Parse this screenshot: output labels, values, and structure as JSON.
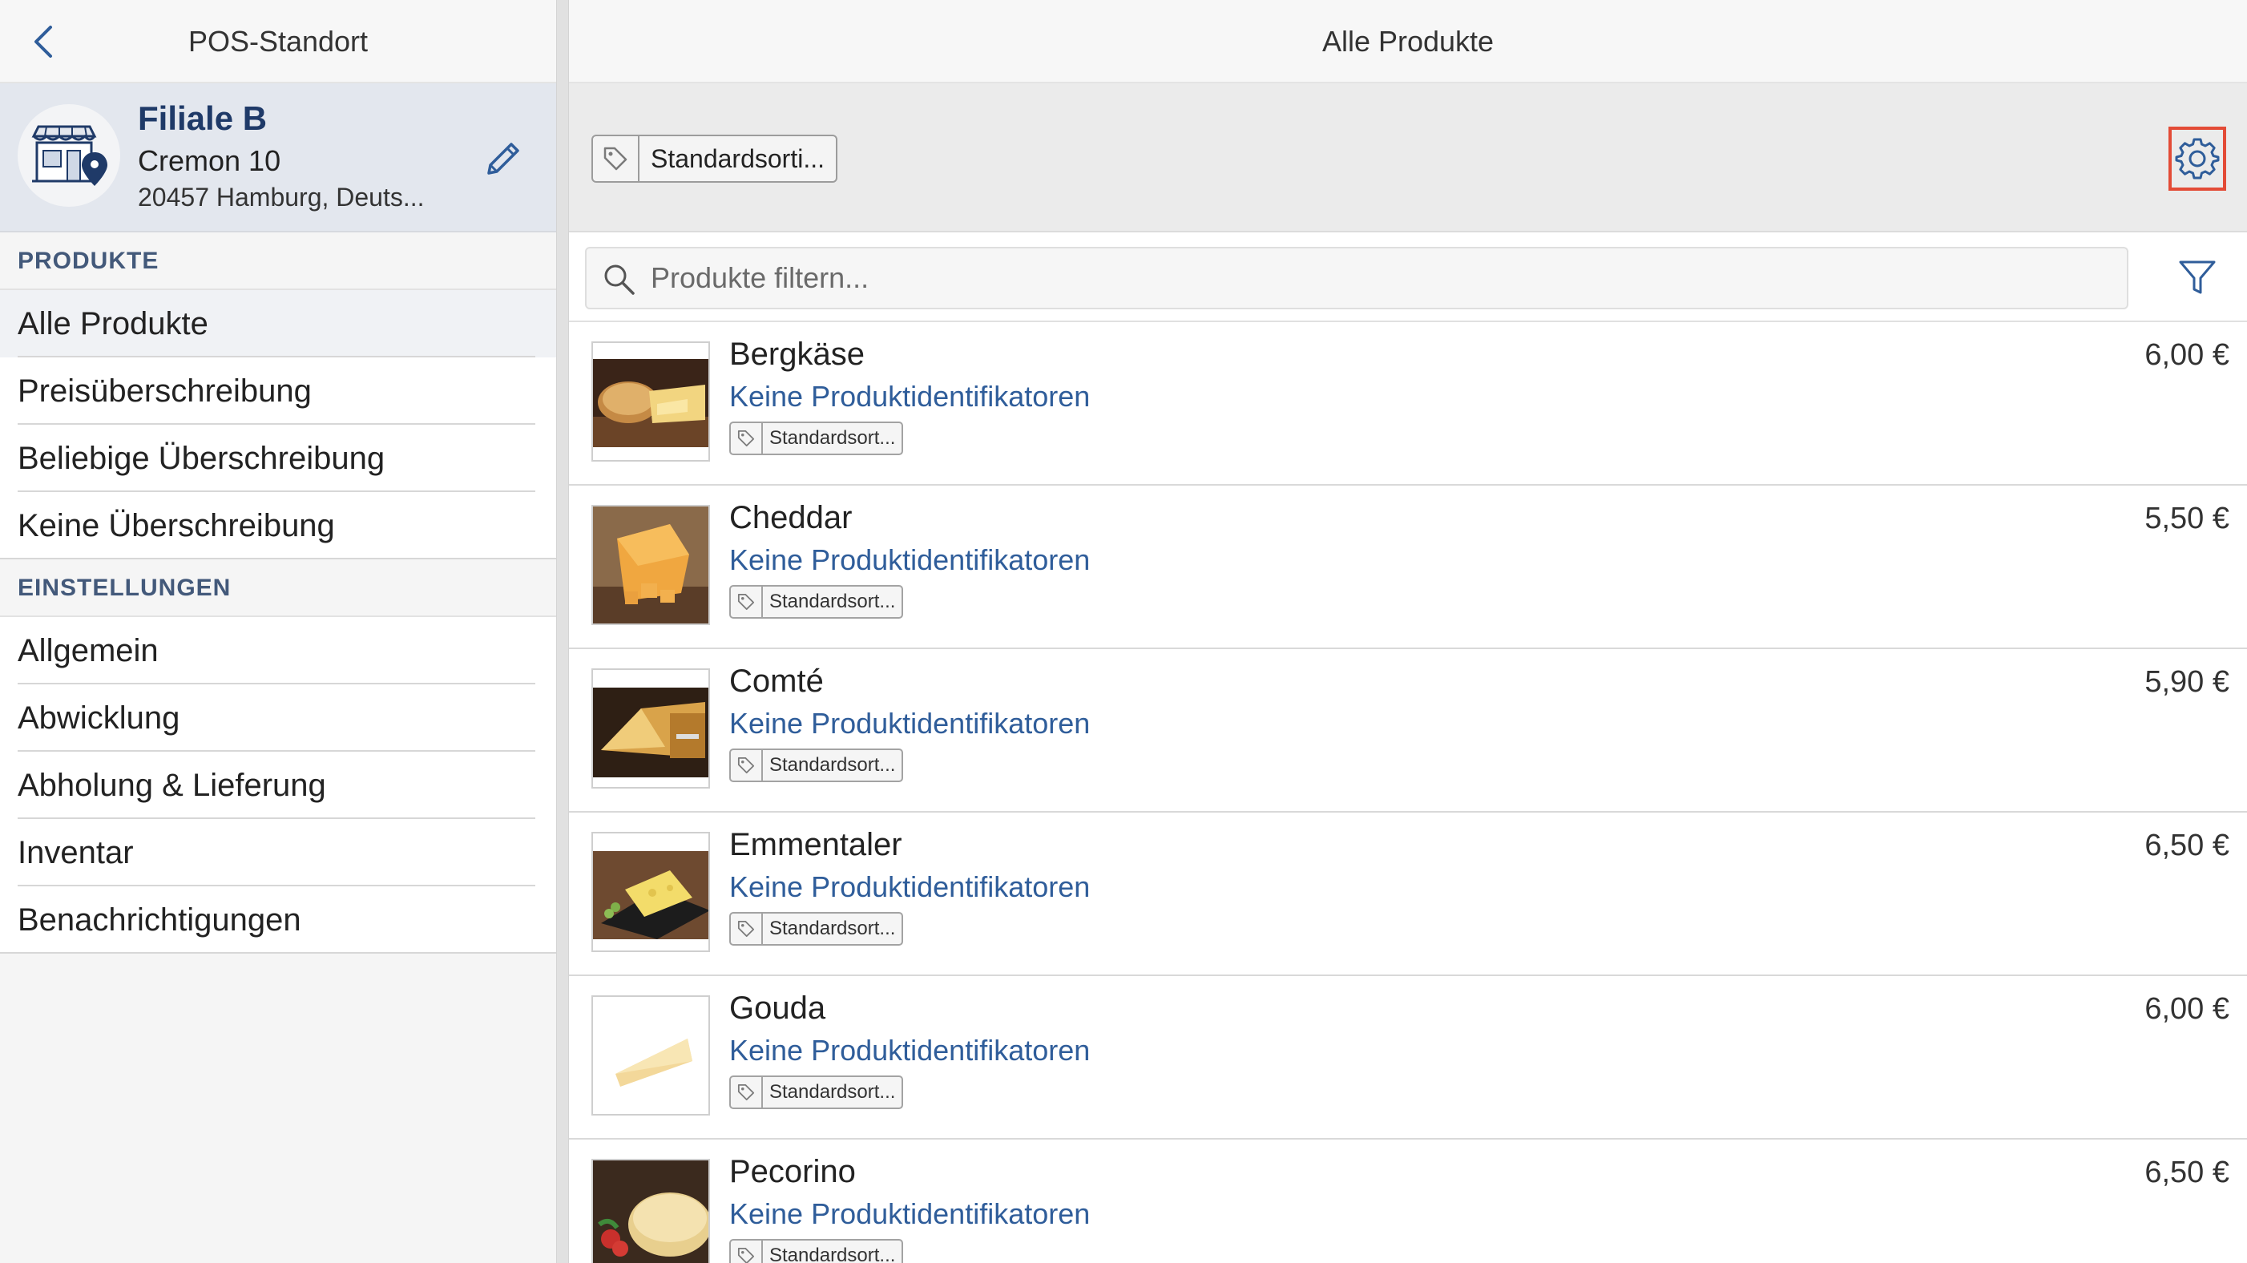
{
  "left_header": {
    "title": "POS-Standort"
  },
  "store": {
    "name": "Filiale B",
    "street": "Cremon 10",
    "city": "20457 Hamburg, Deuts..."
  },
  "sections": [
    {
      "title": "PRODUKTE"
    },
    {
      "title": "EINSTELLUNGEN"
    }
  ],
  "nav_products": [
    {
      "label": "Alle Produkte"
    },
    {
      "label": "Preisüberschreibung"
    },
    {
      "label": "Beliebige Überschreibung"
    },
    {
      "label": "Keine Überschreibung"
    }
  ],
  "nav_settings": [
    {
      "label": "Allgemein"
    },
    {
      "label": "Abwicklung"
    },
    {
      "label": "Abholung & Lieferung"
    },
    {
      "label": "Inventar"
    },
    {
      "label": "Benachrichtigungen"
    }
  ],
  "right_header": {
    "title": "Alle Produkte"
  },
  "toolbar": {
    "assortment_label": "Standardsorti..."
  },
  "search": {
    "placeholder": "Produkte filtern..."
  },
  "products": [
    {
      "name": "Bergkäse",
      "ids": "Keine Produktidentifikatoren",
      "tag": "Standardsort...",
      "price": "6,00 €"
    },
    {
      "name": "Cheddar",
      "ids": "Keine Produktidentifikatoren",
      "tag": "Standardsort...",
      "price": "5,50 €"
    },
    {
      "name": "Comté",
      "ids": "Keine Produktidentifikatoren",
      "tag": "Standardsort...",
      "price": "5,90 €"
    },
    {
      "name": "Emmentaler",
      "ids": "Keine Produktidentifikatoren",
      "tag": "Standardsort...",
      "price": "6,50 €"
    },
    {
      "name": "Gouda",
      "ids": "Keine Produktidentifikatoren",
      "tag": "Standardsort...",
      "price": "6,00 €"
    },
    {
      "name": "Pecorino",
      "ids": "Keine Produktidentifikatoren",
      "tag": "Standardsort...",
      "price": "6,50 €"
    }
  ],
  "icons": {
    "back": "chevron-left-icon",
    "store": "store-location-icon",
    "edit": "pencil-icon",
    "tag": "tag-icon",
    "settings": "gear-icon",
    "search": "search-icon",
    "filter": "filter-icon"
  },
  "colors": {
    "accent_blue": "#2f5d9a",
    "store_name": "#1f3a68",
    "highlight_border": "#e34b36"
  }
}
